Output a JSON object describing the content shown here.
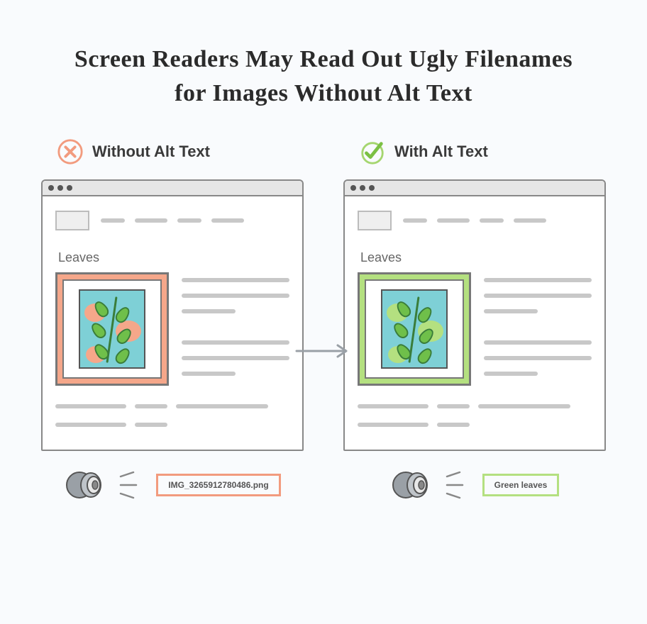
{
  "heading": "Screen Readers May Read Out Ugly Filenames for Images Without Alt Text",
  "left": {
    "label": "Without Alt Text",
    "image_caption": "Leaves",
    "speaker_output": "IMG_3265912780486.png",
    "accent": "#f29b7e"
  },
  "right": {
    "label": "With Alt Text",
    "image_caption": "Leaves",
    "speaker_output": "Green leaves",
    "accent": "#b4e080"
  }
}
